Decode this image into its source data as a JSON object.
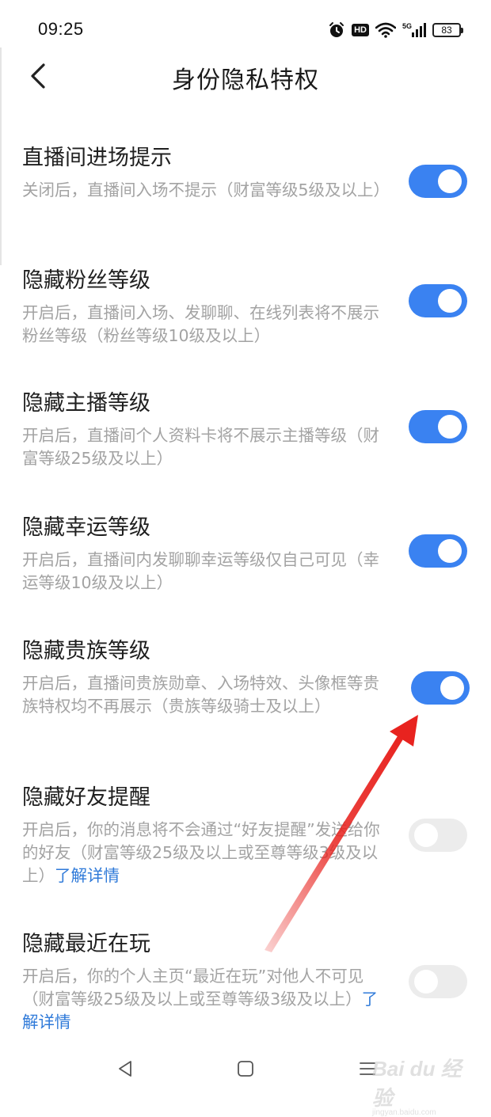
{
  "status_bar": {
    "time": "09:25",
    "hd_label": "HD",
    "network_label": "5G",
    "battery_level": "83",
    "icons": [
      "alarm-icon",
      "hd-icon",
      "wifi-icon",
      "signal-icon",
      "battery-icon"
    ]
  },
  "header": {
    "title": "身份隐私特权",
    "back_icon": "chevron-left-icon"
  },
  "settings": [
    {
      "title": "直播间进场提示",
      "description": "关闭后，直播间入场不提示（财富等级5级及以上）",
      "enabled": true,
      "link": ""
    },
    {
      "title": "隐藏粉丝等级",
      "description": "开启后，直播间入场、发聊聊、在线列表将不展示粉丝等级（粉丝等级10级及以上）",
      "enabled": true,
      "link": ""
    },
    {
      "title": "隐藏主播等级",
      "description": "开启后，直播间个人资料卡将不展示主播等级（财富等级25级及以上）",
      "enabled": true,
      "link": ""
    },
    {
      "title": "隐藏幸运等级",
      "description": "开启后，直播间内发聊聊幸运等级仅自己可见（幸运等级10级及以上）",
      "enabled": true,
      "link": ""
    },
    {
      "title": "隐藏贵族等级",
      "description": "开启后，直播间贵族勋章、入场特效、头像框等贵族特权均不再展示（贵族等级骑士及以上）",
      "enabled": true,
      "link": ""
    },
    {
      "title": "隐藏好友提醒",
      "description": "开启后，你的消息将不会通过“好友提醒”发送给你的好友（财富等级25级及以上或至尊等级3级及以上）",
      "enabled": false,
      "link": "了解详情"
    },
    {
      "title": "隐藏最近在玩",
      "description": "开启后，你的个人主页“最近在玩”对他人不可见（财富等级25级及以上或至尊等级3级及以上）",
      "enabled": false,
      "link": "了解详情"
    }
  ],
  "nav_bar": {
    "icons": [
      "back-triangle-icon",
      "home-square-icon",
      "menu-lines-icon"
    ]
  },
  "watermark": {
    "logo": "Bai du 经验",
    "sub": "jingyan.baidu.com"
  },
  "colors": {
    "accent": "#3a82f1",
    "toggle_off": "#ececec",
    "link": "#2f7ad9",
    "description": "#a3a3a3",
    "annotation_arrow": "#e8231f"
  }
}
